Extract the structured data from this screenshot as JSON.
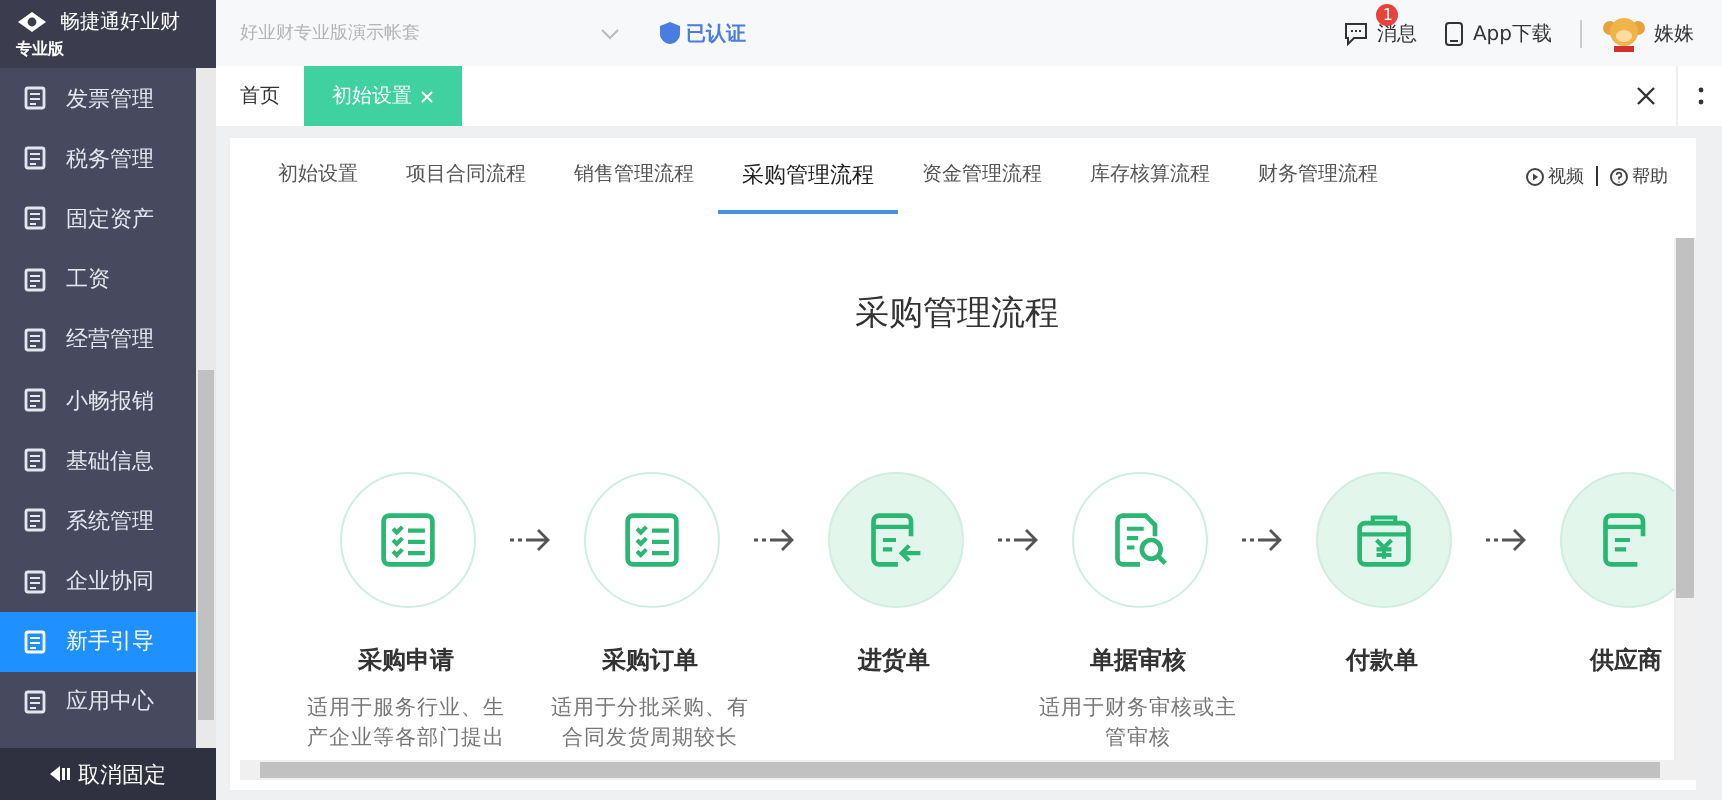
{
  "brand": {
    "name": "畅捷通好业财",
    "edition": "专业版"
  },
  "sidebar": {
    "items": [
      {
        "label": "发票管理",
        "selected": false
      },
      {
        "label": "税务管理",
        "selected": false
      },
      {
        "label": "固定资产",
        "selected": false
      },
      {
        "label": "工资",
        "selected": false
      },
      {
        "label": "经营管理",
        "selected": false
      },
      {
        "label": "小畅报销",
        "selected": false
      },
      {
        "label": "基础信息",
        "selected": false
      },
      {
        "label": "系统管理",
        "selected": false
      },
      {
        "label": "企业协同",
        "selected": false
      },
      {
        "label": "新手引导",
        "selected": true
      },
      {
        "label": "应用中心",
        "selected": false
      }
    ],
    "footer": "取消固定"
  },
  "topbar": {
    "account": {
      "placeholder": "好业财专业版演示帐套"
    },
    "verified": "已认证",
    "messages": {
      "label": "消息",
      "badge": "1"
    },
    "app_download": "App下载",
    "user": "姝姝"
  },
  "page_tabs": [
    {
      "label": "首页",
      "selected": false,
      "closable": false
    },
    {
      "label": "初始设置",
      "selected": true,
      "closable": true
    }
  ],
  "flow_tabs": [
    {
      "label": "初始设置",
      "selected": false
    },
    {
      "label": "项目合同流程",
      "selected": false
    },
    {
      "label": "销售管理流程",
      "selected": false
    },
    {
      "label": "采购管理流程",
      "selected": true
    },
    {
      "label": "资金管理流程",
      "selected": false
    },
    {
      "label": "库存核算流程",
      "selected": false
    },
    {
      "label": "财务管理流程",
      "selected": false
    }
  ],
  "links": {
    "video": "视频",
    "help": "帮助"
  },
  "flow": {
    "title": "采购管理流程",
    "steps": [
      {
        "kind": "checklist",
        "filled": false,
        "title": "采购申请",
        "description": [
          "适用于服务行业、生",
          "产企业等各部门提出"
        ]
      },
      {
        "kind": "checklist",
        "filled": false,
        "title": "采购订单",
        "description": [
          "适用于分批采购、有",
          "合同发货周期较长"
        ]
      },
      {
        "kind": "inbound",
        "filled": true,
        "title": "进货单"
      },
      {
        "kind": "audit",
        "filled": false,
        "title": "单据审核",
        "description": [
          "适用于财务审核或主",
          "管审核"
        ]
      },
      {
        "kind": "payment",
        "filled": true,
        "title": "付款单"
      },
      {
        "kind": "doc",
        "filled": true,
        "title": "供应商"
      }
    ]
  }
}
